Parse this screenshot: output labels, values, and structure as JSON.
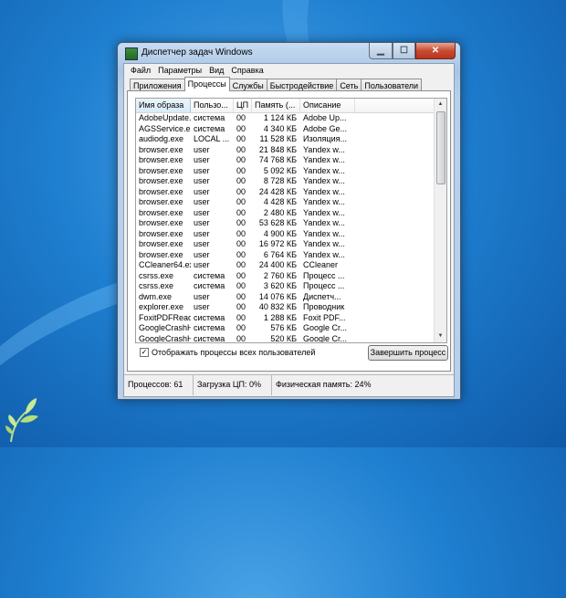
{
  "window": {
    "title": "Диспетчер задач Windows"
  },
  "menu": [
    "Файл",
    "Параметры",
    "Вид",
    "Справка"
  ],
  "tabs": [
    "Приложения",
    "Процессы",
    "Службы",
    "Быстродействие",
    "Сеть",
    "Пользователи"
  ],
  "active_tab": 1,
  "table": {
    "columns": [
      "Имя образа",
      "Пользо...",
      "ЦП",
      "Память (...",
      "Описание"
    ],
    "rows": [
      [
        "AdobeUpdate...",
        "система",
        "00",
        "1 124 КБ",
        "Adobe Up..."
      ],
      [
        "AGSService.e...",
        "система",
        "00",
        "4 340 КБ",
        "Adobe Ge..."
      ],
      [
        "audiodg.exe",
        "LOCAL ...",
        "00",
        "11 528 КБ",
        "Изоляция..."
      ],
      [
        "browser.exe",
        "user",
        "00",
        "21 848 КБ",
        "Yandex w..."
      ],
      [
        "browser.exe",
        "user",
        "00",
        "74 768 КБ",
        "Yandex w..."
      ],
      [
        "browser.exe",
        "user",
        "00",
        "5 092 КБ",
        "Yandex w..."
      ],
      [
        "browser.exe",
        "user",
        "00",
        "8 728 КБ",
        "Yandex w..."
      ],
      [
        "browser.exe",
        "user",
        "00",
        "24 428 КБ",
        "Yandex w..."
      ],
      [
        "browser.exe",
        "user",
        "00",
        "4 428 КБ",
        "Yandex w..."
      ],
      [
        "browser.exe",
        "user",
        "00",
        "2 480 КБ",
        "Yandex w..."
      ],
      [
        "browser.exe",
        "user",
        "00",
        "53 628 КБ",
        "Yandex w..."
      ],
      [
        "browser.exe",
        "user",
        "00",
        "4 900 КБ",
        "Yandex w..."
      ],
      [
        "browser.exe",
        "user",
        "00",
        "16 972 КБ",
        "Yandex w..."
      ],
      [
        "browser.exe",
        "user",
        "00",
        "6 764 КБ",
        "Yandex w..."
      ],
      [
        "CCleaner64.exe",
        "user",
        "00",
        "24 400 КБ",
        "CCleaner"
      ],
      [
        "csrss.exe",
        "система",
        "00",
        "2 760 КБ",
        "Процесс ..."
      ],
      [
        "csrss.exe",
        "система",
        "00",
        "3 620 КБ",
        "Процесс ..."
      ],
      [
        "dwm.exe",
        "user",
        "00",
        "14 076 КБ",
        "Диспетч..."
      ],
      [
        "explorer.exe",
        "user",
        "00",
        "40 832 КБ",
        "Проводник"
      ],
      [
        "FoxitPDFRead...",
        "система",
        "00",
        "1 288 КБ",
        "Foxit PDF..."
      ],
      [
        "GoogleCrashH...",
        "система",
        "00",
        "576 КБ",
        "Google Cr..."
      ],
      [
        "GoogleCrashH...",
        "система",
        "00",
        "520 КБ",
        "Google Cr..."
      ]
    ]
  },
  "show_all_users": {
    "label": "Отображать процессы всех пользователей",
    "checked": "✓"
  },
  "end_process_button": "Завершить процесс",
  "status": {
    "processes": "Процессов: 61",
    "cpu": "Загрузка ЦП: 0%",
    "memory": "Физическая память: 24%"
  }
}
